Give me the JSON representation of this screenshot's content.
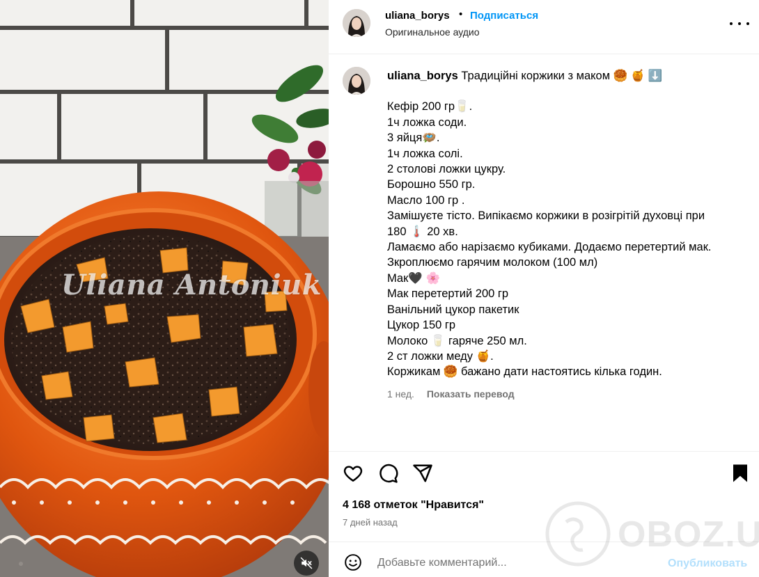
{
  "media": {
    "watermark": "Uliana Antoniuk",
    "mute_icon": "speaker-muted-icon"
  },
  "header": {
    "username": "uliana_borys",
    "separator": "•",
    "follow_label": "Подписаться",
    "audio_label": "Оригинальное аудио",
    "more_icon": "more-options-icon"
  },
  "caption": {
    "username": "uliana_borys",
    "title": "Традиційні коржики з маком 🥮 🍯 ⬇️",
    "lines": [
      "Кефір 200 гр🥛.",
      "1ч ложка соди.",
      "3 яйця🪺.",
      "1ч ложка солі.",
      "2 столові ложки цукру.",
      "Борошно 550 гр.",
      "Масло 100 гр .",
      "Замішуєте тісто. Випікаємо коржики в розігрітій духовці при",
      "180 🌡️ 20 хв.",
      "Ламаємо або нарізаємо кубиками. Додаємо перетертий мак.",
      "Зкроплюємо гарячим молоком (100 мл)",
      "Мак🖤 🌸",
      "Мак перетертий 200 гр",
      "Ванільний цукор пакетик",
      "Цукор 150 гр",
      "Молоко 🥛 гаряче 250 мл.",
      "2 ст ложки меду 🍯.",
      "Коржикам 🥮 бажано дати настоятись кілька годин."
    ],
    "time": "1 нед.",
    "translate_label": "Показать перевод"
  },
  "actions": {
    "likes": "4 168 отметок \"Нравится\"",
    "posted_ago": "7 дней назад",
    "icons": [
      "heart-icon",
      "comment-icon",
      "share-icon",
      "bookmark-icon"
    ]
  },
  "comment": {
    "placeholder": "Добавьте комментарий...",
    "publish_label": "Опубликовать"
  },
  "site_watermark": "OBOZ.UA",
  "colors": {
    "accent": "#0095f6",
    "publish_disabled": "#b2dffc",
    "pot": "#e0560f"
  }
}
